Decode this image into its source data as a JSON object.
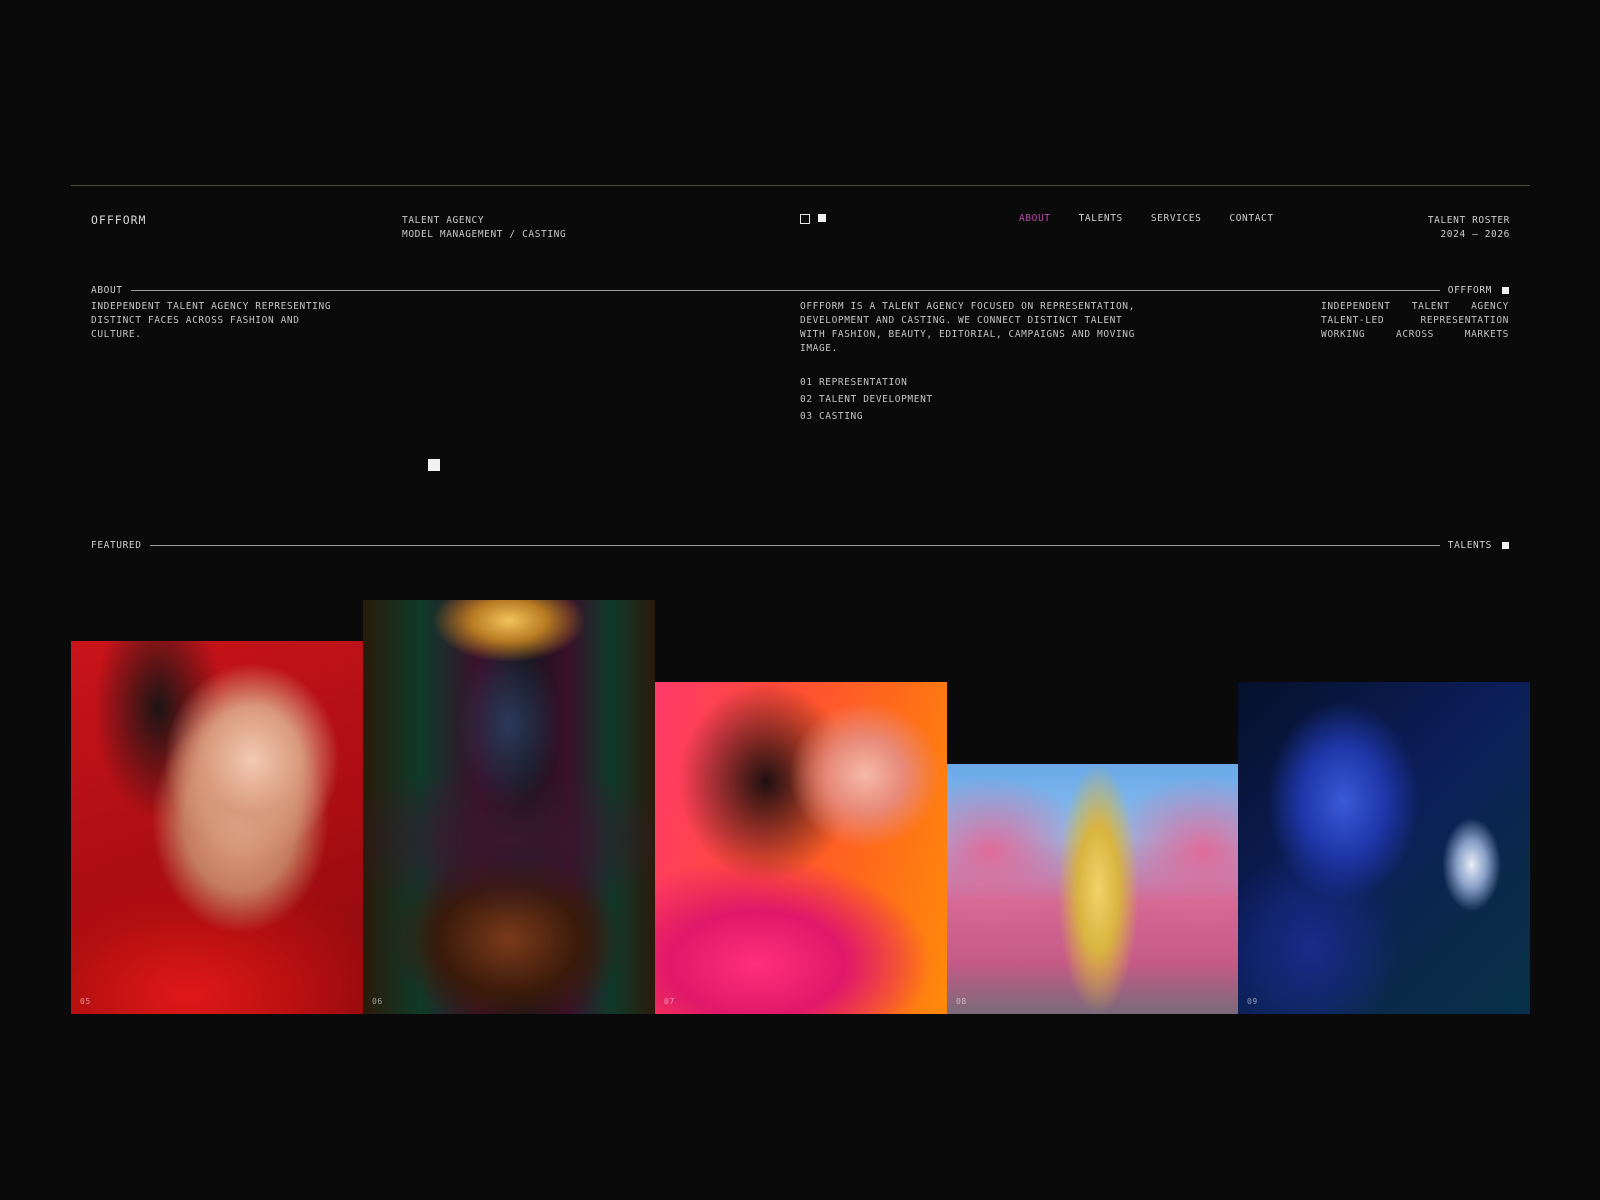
{
  "header": {
    "logo": "OFFFORM",
    "tagline_line1": "TALENT AGENCY",
    "tagline_line2": "MODEL MANAGEMENT / CASTING",
    "nav": [
      {
        "label": "ABOUT",
        "active": true
      },
      {
        "label": "TALENTS",
        "active": false
      },
      {
        "label": "SERVICES",
        "active": false
      },
      {
        "label": "CONTACT",
        "active": false
      }
    ],
    "roster_line1": "TALENT ROSTER",
    "roster_line2": "2024 — 2026"
  },
  "about": {
    "label": "ABOUT",
    "end_label": "OFFFORM",
    "left_text": "INDEPENDENT TALENT AGENCY REPRESENTING DISTINCT FACES ACROSS FASHION AND CULTURE.",
    "mid_text": "OFFFORM IS A TALENT AGENCY FOCUSED ON REPRESENTATION, DEVELOPMENT AND CASTING. WE CONNECT DISTINCT TALENT WITH FASHION, BEAUTY, EDITORIAL, CAMPAIGNS AND MOVING IMAGE.",
    "services": [
      "01 REPRESENTATION",
      "02 TALENT DEVELOPMENT",
      "03 CASTING"
    ],
    "right_text": "INDEPENDENT TALENT AGENCY TALENT-LED REPRESENTATION WORKING ACROSS MARKETS"
  },
  "featured": {
    "label": "FEATURED",
    "end_label": "TALENTS",
    "cards": [
      {
        "number": "05"
      },
      {
        "number": "06"
      },
      {
        "number": "07"
      },
      {
        "number": "08"
      },
      {
        "number": "09"
      }
    ]
  },
  "colors": {
    "background": "#0a0a0a",
    "text": "#c9c9c9",
    "accent": "#b84aa8"
  }
}
